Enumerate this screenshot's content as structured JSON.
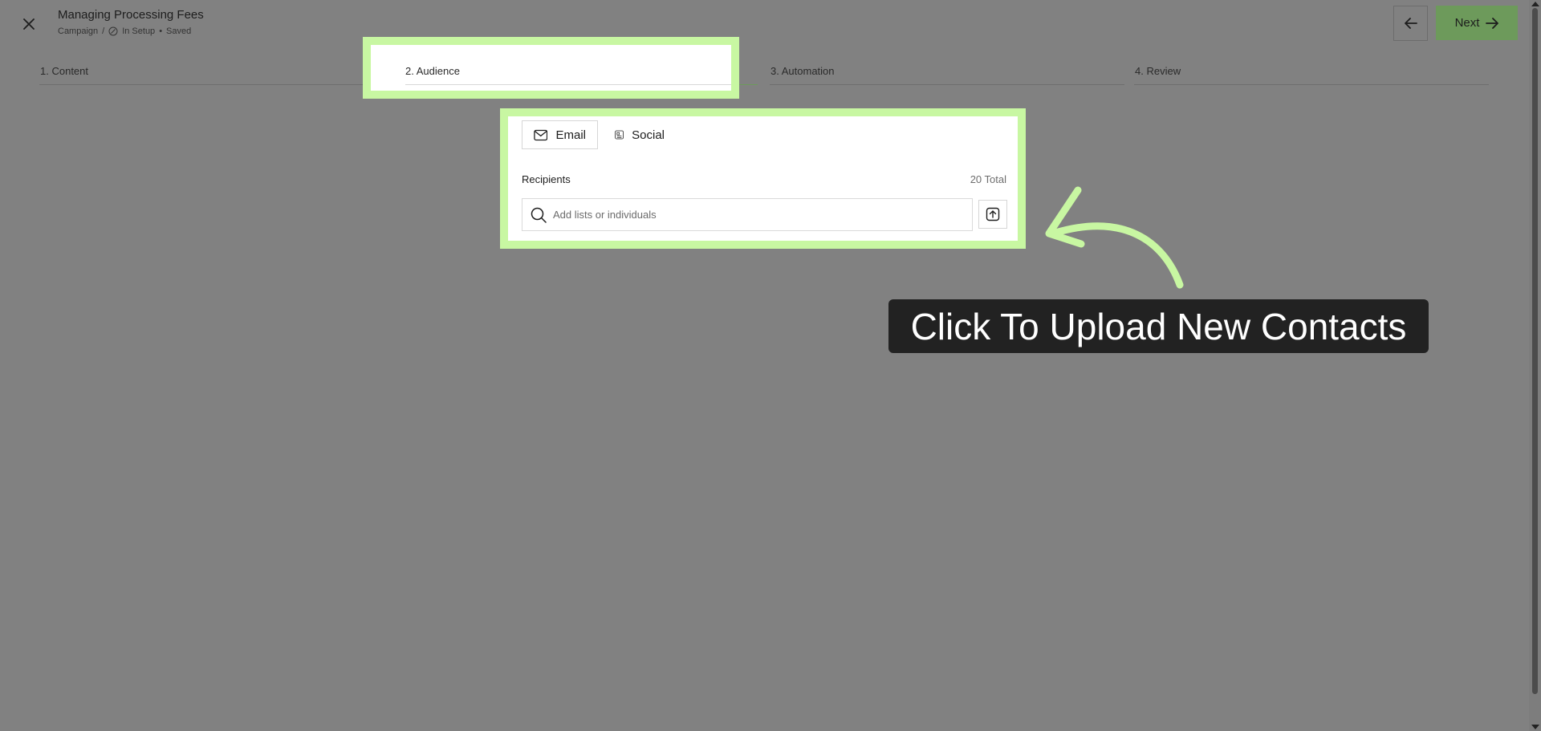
{
  "header": {
    "title": "Managing Processing Fees",
    "breadcrumb_root": "Campaign",
    "separator": "/",
    "status": "In Setup",
    "status_separator": "•",
    "save_state": "Saved",
    "next_label": "Next"
  },
  "steps": [
    {
      "number": "1.",
      "label": "Content"
    },
    {
      "number": "2.",
      "label": "Audience"
    },
    {
      "number": "3.",
      "label": "Automation"
    },
    {
      "number": "4.",
      "label": "Review"
    }
  ],
  "channels": {
    "email_label": "Email",
    "social_label": "Social"
  },
  "recipients": {
    "label": "Recipients",
    "total": "20 Total",
    "search_placeholder": "Add lists or individuals"
  },
  "annotation": {
    "text": "Click To Upload New Contacts"
  },
  "colors": {
    "highlight": "#c8f7a2",
    "next_button": "#6d9a5b",
    "overlay": "#818181",
    "tooltip_bg": "#222222"
  }
}
